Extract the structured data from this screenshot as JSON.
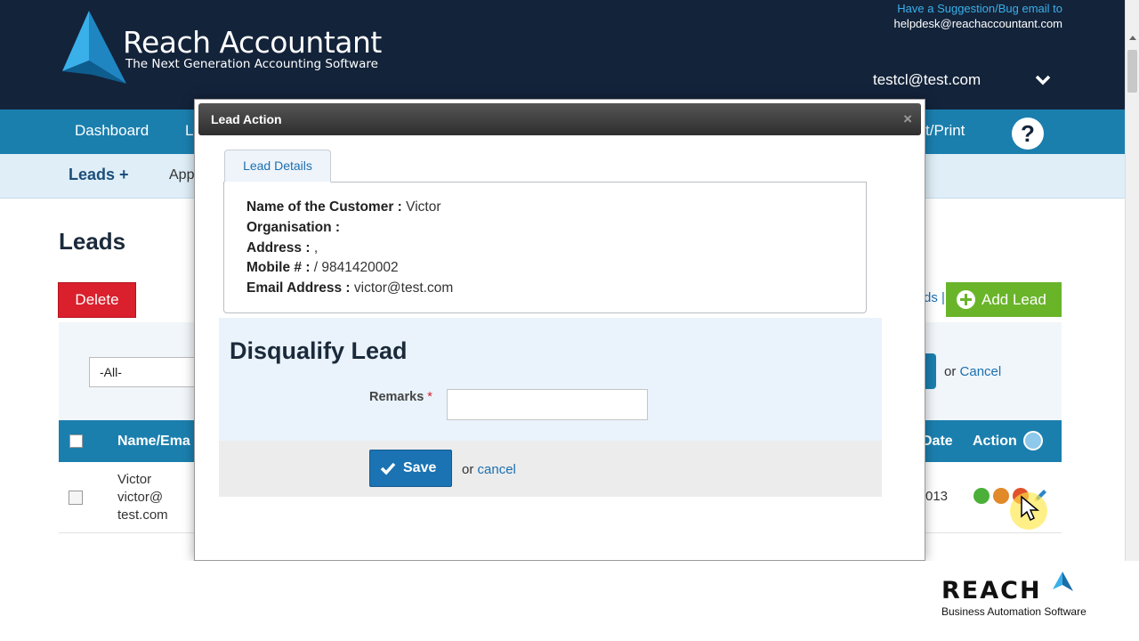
{
  "header": {
    "brand_name": "Reach Accountant",
    "brand_tagline": "The Next Generation Accounting Software",
    "suggestion_text": "Have a Suggestion/Bug email to",
    "helpdesk_email": "helpdesk@reachaccountant.com",
    "user_email": "testcl@test.com"
  },
  "nav": {
    "items": [
      {
        "label": "Dashboard"
      },
      {
        "label": "L"
      },
      {
        "label": "t/Print"
      }
    ],
    "help_label": "?"
  },
  "subnav": {
    "leads_label": "Leads +",
    "app_label": "App"
  },
  "page": {
    "title": "Leads",
    "delete_label": "Delete",
    "leads_link": "ds |",
    "add_lead_label": "Add Lead",
    "filter_value": "-All-",
    "filter_or": "or",
    "filter_cancel": "Cancel"
  },
  "table": {
    "headers": {
      "name": "Name/Ema",
      "date": "Date",
      "action": "Action"
    },
    "rows": [
      {
        "name": "Victor",
        "email_line1": "victor@",
        "email_line2": "test.com",
        "date": "013"
      }
    ]
  },
  "modal": {
    "title": "Lead Action",
    "close": "×",
    "tab_label": "Lead Details",
    "details": [
      {
        "label": "Name of the Customer :",
        "value": "Victor"
      },
      {
        "label": "Organisation :",
        "value": ""
      },
      {
        "label": "Address :",
        "value": ","
      },
      {
        "label": "Mobile # :",
        "value": "/ 9841420002"
      },
      {
        "label": "Email Address :",
        "value": "victor@test.com"
      }
    ],
    "section_title": "Disqualify Lead",
    "remarks_label": "Remarks",
    "required_mark": "*",
    "remarks_value": "",
    "save_label": "Save",
    "or_text": "or",
    "cancel_label": "cancel"
  },
  "watermark": {
    "logo_text": "REACH",
    "tagline": "Business Automation Software"
  },
  "colors": {
    "header_bg": "#13233a",
    "nav_bg": "#1b7fae",
    "delete": "#d9202c",
    "add_lead": "#6ab42a",
    "save": "#1b73b4",
    "link": "#1c6fb0"
  },
  "icons": {
    "action_approve": "check-circle-icon",
    "action_convert": "convert-icon",
    "action_disqualify": "disqualify-icon",
    "action_edit": "pencil-icon",
    "refresh": "refresh-icon"
  }
}
